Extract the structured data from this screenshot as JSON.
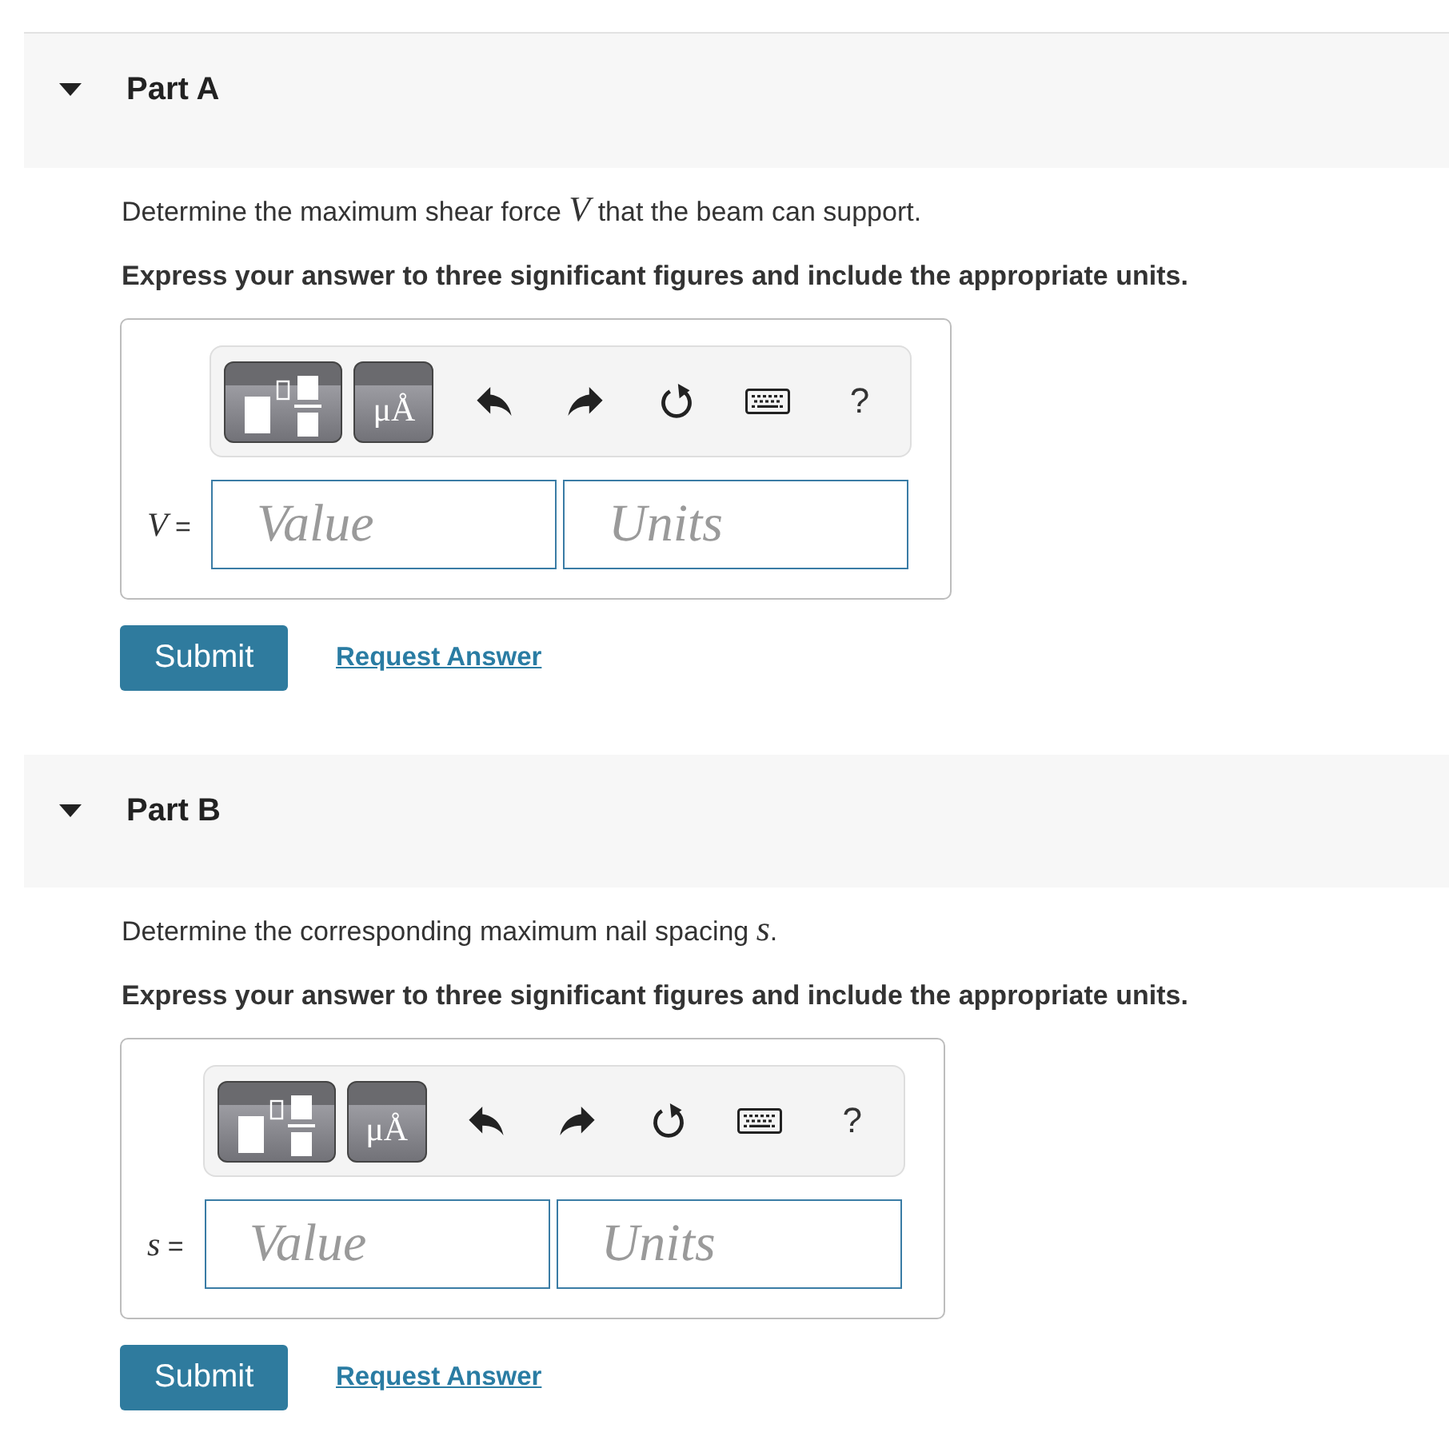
{
  "parts": [
    {
      "title": "Part A",
      "expanded": true,
      "question": "Determine the maximum shear force *V* that the beam can support.",
      "instruction": "Express your answer to three significant figures and include the appropriate units.",
      "toolbar": {
        "units_button": "μÅ",
        "help_button": "?"
      },
      "answer": {
        "label": "*V* =",
        "value_placeholder": "Value",
        "units_placeholder": "Units"
      },
      "submit": "Submit",
      "request_answer": "Request Answer"
    },
    {
      "title": "Part B",
      "expanded": true,
      "question": "Determine the corresponding maximum nail spacing *s*.",
      "instruction": "Express your answer to three significant figures and include the appropriate units.",
      "toolbar": {
        "units_button": "μÅ",
        "help_button": "?"
      },
      "answer": {
        "label": "*s* =",
        "value_placeholder": "Value",
        "units_placeholder": "Units"
      },
      "submit": "Submit",
      "request_answer": "Request Answer"
    }
  ]
}
